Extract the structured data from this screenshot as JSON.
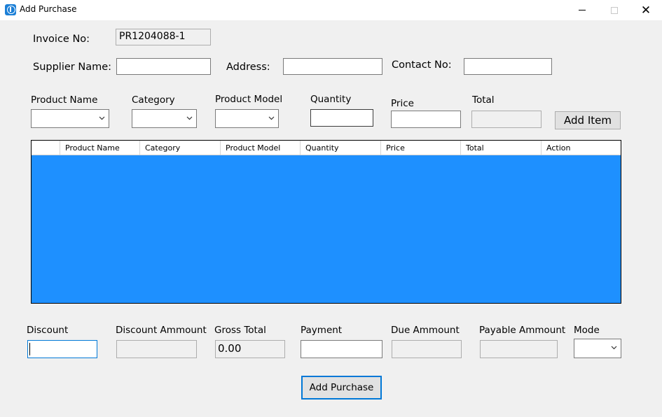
{
  "window": {
    "title": "Add Purchase"
  },
  "invoice": {
    "label": "Invoice No:",
    "value": "PR1204088-1"
  },
  "supplier": {
    "name_label": "Supplier Name:",
    "name_value": "",
    "address_label": "Address:",
    "address_value": "",
    "contact_label": "Contact No:",
    "contact_value": ""
  },
  "item": {
    "product_name_label": "Product Name",
    "category_label": "Category",
    "product_model_label": "Product Model",
    "quantity_label": "Quantity",
    "price_label": "Price",
    "total_label": "Total",
    "add_item_label": "Add Item"
  },
  "grid": {
    "columns": [
      "",
      "Product Name",
      "Category",
      "Product Model",
      "Quantity",
      "Price",
      "Total",
      "Action"
    ],
    "rows": [],
    "background_color": "#1e90ff"
  },
  "summary": {
    "discount_label": "Discount",
    "discount_value": "",
    "discount_amount_label": "Discount Ammount",
    "gross_total_label": "Gross Total",
    "gross_total_value": "0.00",
    "payment_label": "Payment",
    "due_amount_label": "Due Ammount",
    "payable_amount_label": "Payable Ammount",
    "mode_label": "Mode"
  },
  "actions": {
    "add_purchase_label": "Add Purchase"
  },
  "icons": {
    "app": "info-app-icon",
    "minimize": "minimize-icon",
    "maximize": "maximize-icon",
    "close": "close-icon",
    "dropdown": "chevron-down-icon"
  }
}
